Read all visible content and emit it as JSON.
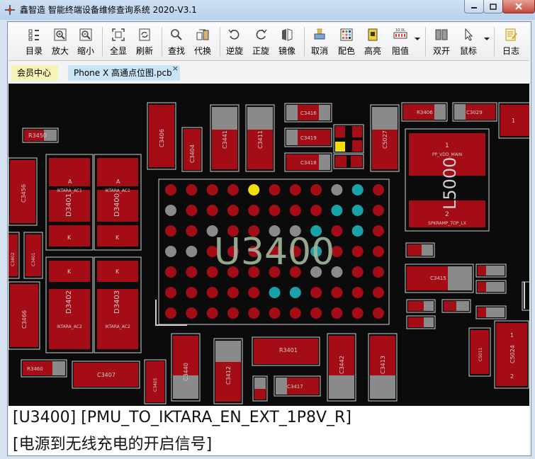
{
  "window": {
    "title": "鑫智造 智能终端设备维修查询系统 2020-V3.1"
  },
  "toolbar": {
    "items": [
      {
        "label": "目录",
        "icon": "directory-icon"
      },
      {
        "label": "放大",
        "icon": "zoom-in-icon"
      },
      {
        "label": "缩小",
        "icon": "zoom-out-icon"
      },
      {
        "label": "全显",
        "icon": "fit-all-icon"
      },
      {
        "label": "刷新",
        "icon": "refresh-icon"
      },
      {
        "label": "查找",
        "icon": "search-icon"
      },
      {
        "label": "代换",
        "icon": "substitute-icon"
      },
      {
        "label": "逆旋",
        "icon": "rotate-ccw-icon"
      },
      {
        "label": "正旋",
        "icon": "rotate-cw-icon"
      },
      {
        "label": "镜像",
        "icon": "mirror-icon"
      },
      {
        "label": "取消",
        "icon": "cancel-icon"
      },
      {
        "label": "配色",
        "icon": "color-scheme-icon"
      },
      {
        "label": "高亮",
        "icon": "highlight-icon"
      },
      {
        "label": "阻值",
        "icon": "resistance-icon"
      },
      {
        "label": "双开",
        "icon": "dual-view-icon"
      },
      {
        "label": "鼠标",
        "icon": "mouse-pointer-icon"
      },
      {
        "label": "日志",
        "icon": "log-icon"
      }
    ]
  },
  "tabs": [
    {
      "label": "会员中心"
    },
    {
      "label": "Phone X 高通点位图.pcb",
      "close": "×"
    }
  ],
  "board": {
    "chip_label": "U3400",
    "components": {
      "R3450": "R3450",
      "C3406": "C3406",
      "C3404": "C3404",
      "C3441": "C3441",
      "C3411": "C3411",
      "C3416": "C3416",
      "C3419": "C3419",
      "C3418": "C3418",
      "C5027": "C5027",
      "R3406": "R3406",
      "C3029": "C3029",
      "L5000": "L5000",
      "L5000_pin1": "1",
      "L5000_net1": "PP_VDD_MAIN",
      "L5000_pin2": "2",
      "L5000_net2": "SPKRAMP_TOP_LX",
      "C3456": "C3456",
      "D3401": "D3401",
      "D3400": "D3400",
      "D3402": "D3402",
      "D3403": "D3403",
      "diode_A": "A",
      "diode_K": "K",
      "iktara_ac1": "IKTARA_AC1",
      "iktara_ac2": "IKTARA_AC2",
      "C3402": "C3402",
      "C3401": "C3401",
      "C3466": "C3466",
      "C3415": "C3415",
      "R3460": "R3460",
      "C3407": "C3407",
      "C3405": "C3405",
      "C3440": "C3440",
      "C3412": "C3412",
      "R3401": "R3401",
      "C3417": "C3417",
      "C3442": "C3442",
      "C3413": "C3413",
      "C5011": "C5011",
      "C5024": "C5024",
      "pin1": "1",
      "pin2": "2"
    }
  },
  "status": {
    "line1": "[U3400] [PMU_TO_IKTARA_EN_EXT_1P8V_R]",
    "line2": "[电源到无线充电的开启信号]"
  },
  "colors": {
    "pad_red": "#a40c16",
    "pad_gray": "#8a8a8a",
    "pad_teal": "#19a3a8",
    "pad_yellow": "#f2e008",
    "chip_text": "#9fb49a",
    "silk": "#cfcfcf"
  }
}
